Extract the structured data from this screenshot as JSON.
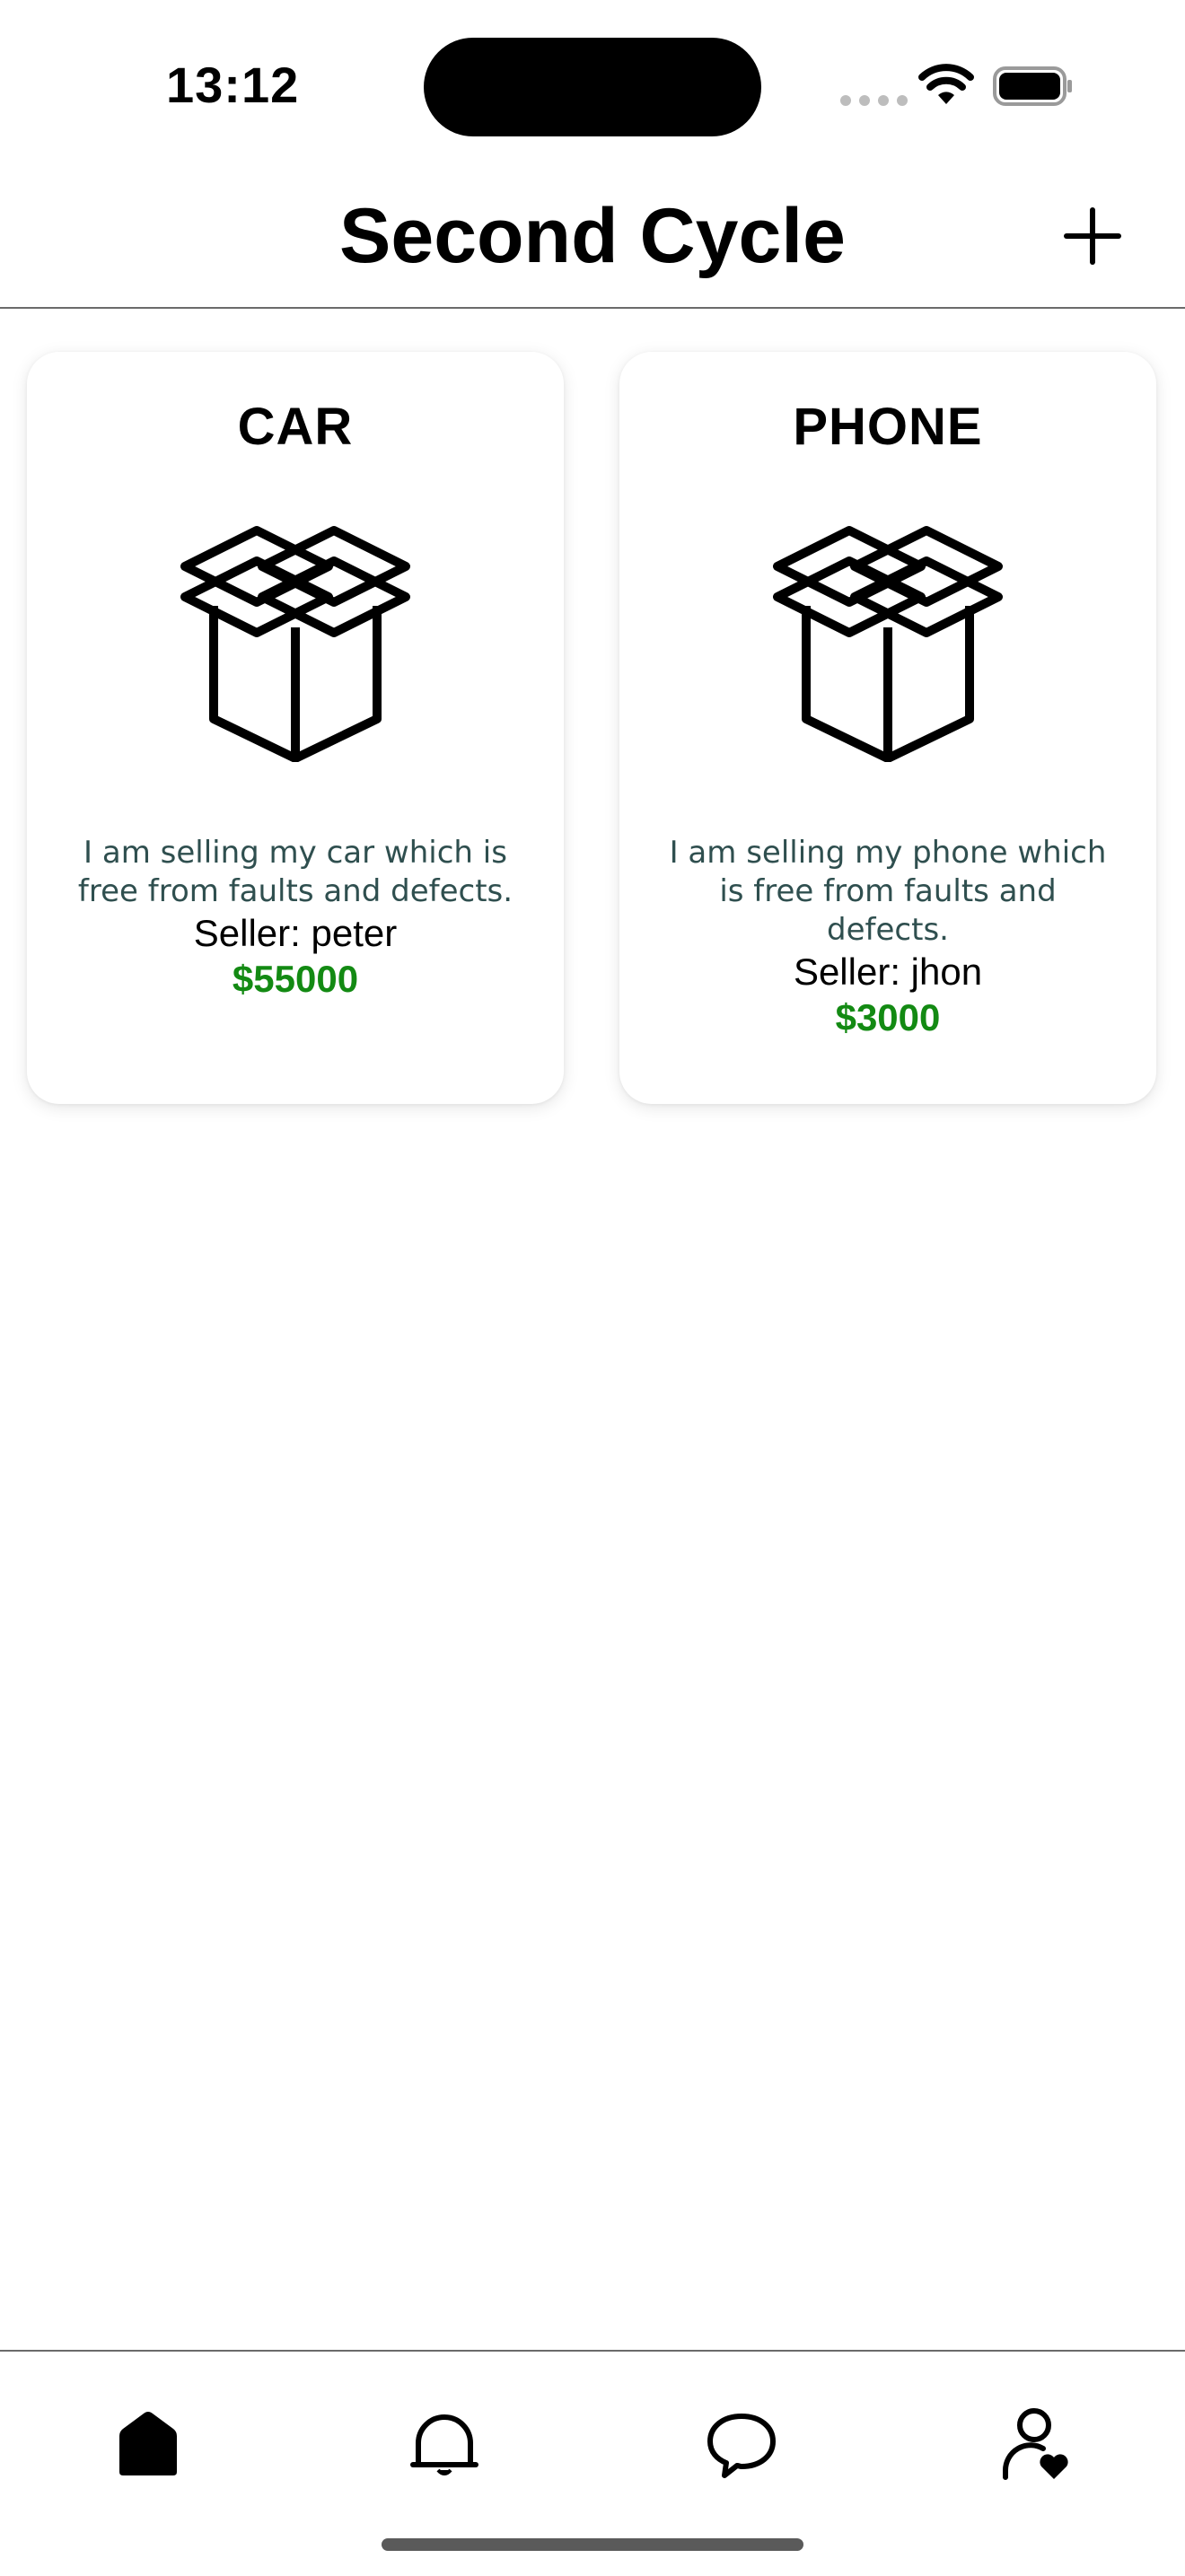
{
  "status_bar": {
    "time": "13:12"
  },
  "header": {
    "title": "Second Cycle",
    "add_icon": "plus-icon"
  },
  "listings": [
    {
      "title": "CAR",
      "icon": "box-icon",
      "description": "I am selling my car which is free from faults and defects.",
      "seller": "Seller: peter",
      "price": "$55000"
    },
    {
      "title": "PHONE",
      "icon": "box-icon",
      "description": "I am selling my phone which is free from faults and defects.",
      "seller": "Seller: jhon",
      "price": "$3000"
    }
  ],
  "tab_bar": {
    "items": [
      {
        "icon": "home-icon",
        "active": true
      },
      {
        "icon": "bell-icon",
        "active": false
      },
      {
        "icon": "chat-bubble-icon",
        "active": false
      },
      {
        "icon": "profile-heart-icon",
        "active": false
      }
    ]
  },
  "colors": {
    "price": "#138a13",
    "description": "#2f4f4f",
    "divider": "#6b6b6b"
  }
}
